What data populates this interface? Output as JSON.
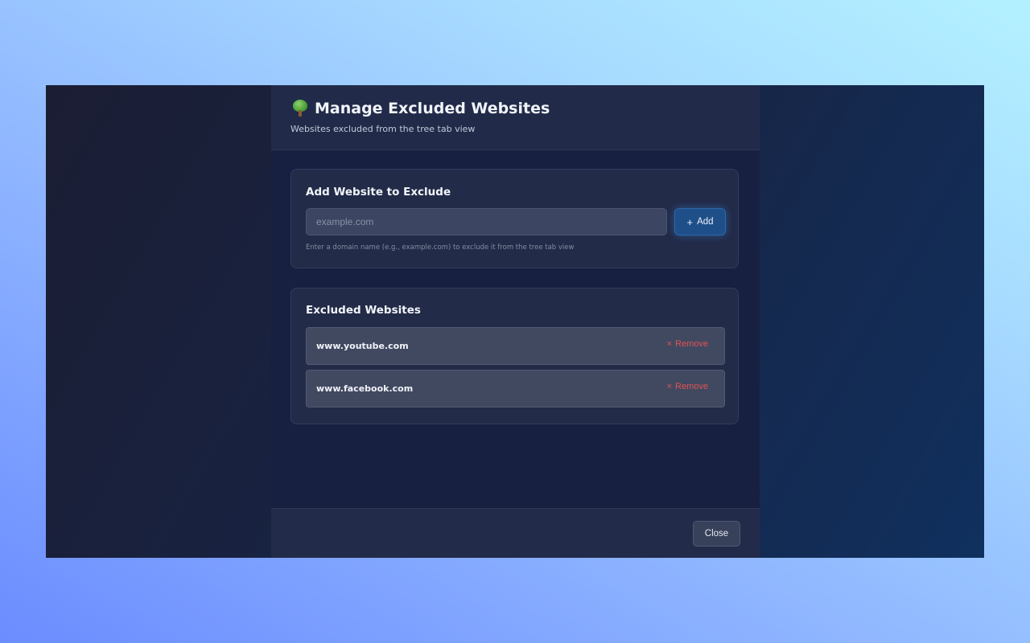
{
  "header": {
    "title": "Manage Excluded Websites",
    "subtitle": "Websites excluded from the tree tab view",
    "icon": "tree-icon"
  },
  "add_section": {
    "title": "Add Website to Exclude",
    "input_value": "",
    "input_placeholder": "example.com",
    "add_button_icon": "+",
    "add_button_label": "Add",
    "hint": "Enter a domain name (e.g., example.com) to exclude it from the tree tab view"
  },
  "excluded_section": {
    "title": "Excluded Websites",
    "remove_icon": "×",
    "remove_label": "Remove",
    "sites": [
      {
        "domain": "www.youtube.com"
      },
      {
        "domain": "www.facebook.com"
      }
    ]
  },
  "footer": {
    "close_label": "Close"
  },
  "colors": {
    "accent": "#1f4f88",
    "danger": "#e05252",
    "panel_bg": "#172040",
    "card_bg": "#222b48"
  }
}
